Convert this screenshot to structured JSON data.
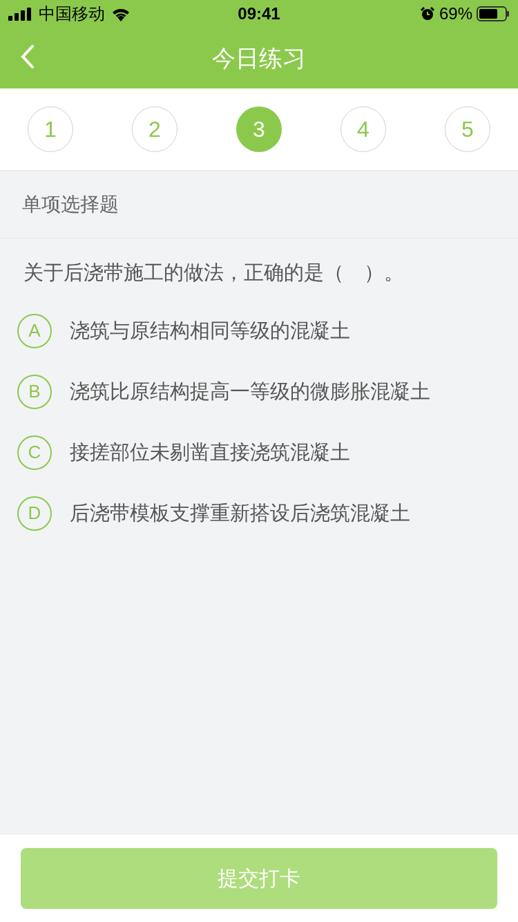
{
  "status_bar": {
    "carrier": "中国移动",
    "time": "09:41",
    "battery": "69%"
  },
  "header": {
    "title": "今日练习"
  },
  "question_nav": [
    {
      "label": "1",
      "selected": false
    },
    {
      "label": "2",
      "selected": false
    },
    {
      "label": "3",
      "selected": true
    },
    {
      "label": "4",
      "selected": false
    },
    {
      "label": "5",
      "selected": false
    }
  ],
  "question_type": "单项选择题",
  "question": "关于后浇带施工的做法，正确的是（　）。",
  "options": [
    {
      "letter": "A",
      "text": "浇筑与原结构相同等级的混凝土",
      "selected": false
    },
    {
      "letter": "B",
      "text": "浇筑比原结构提高一等级的微膨胀混凝土",
      "selected": false
    },
    {
      "letter": "C",
      "text": "接搓部位未剔凿直接浇筑混凝土",
      "selected": false
    },
    {
      "letter": "D",
      "text": "后浇带模板支撑重新搭设后浇筑混凝土",
      "selected": false
    }
  ],
  "submit": {
    "label": "提交打卡",
    "disabled": true
  }
}
